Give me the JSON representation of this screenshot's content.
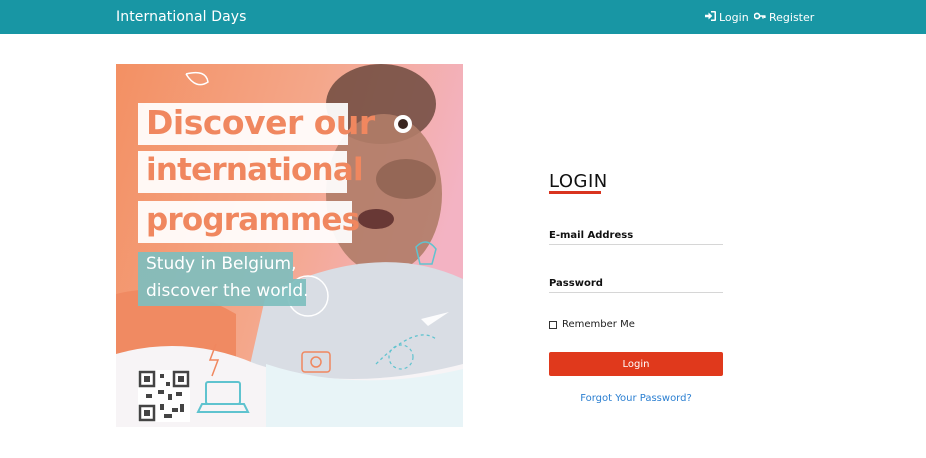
{
  "navbar": {
    "brand": "International Days",
    "background": "#1896a4",
    "login_label": "Login",
    "login_icon": "sign-in-icon",
    "register_label": "Register",
    "register_icon": "key-icon"
  },
  "hero": {
    "line1": "Discover our",
    "line2": "international",
    "line3": "programmes",
    "sub1": "Study in Belgium,",
    "sub2": "discover the world."
  },
  "login": {
    "title": "LOGIN",
    "accent": "#d9341f",
    "email_label": "E-mail Address",
    "email_value": "",
    "password_label": "Password",
    "password_value": "",
    "remember_label": "Remember Me",
    "remember_checked": false,
    "submit_label": "Login",
    "submit_color": "#e0391c",
    "forgot_label": "Forgot Your Password?",
    "link_color": "#2b7fd1"
  }
}
